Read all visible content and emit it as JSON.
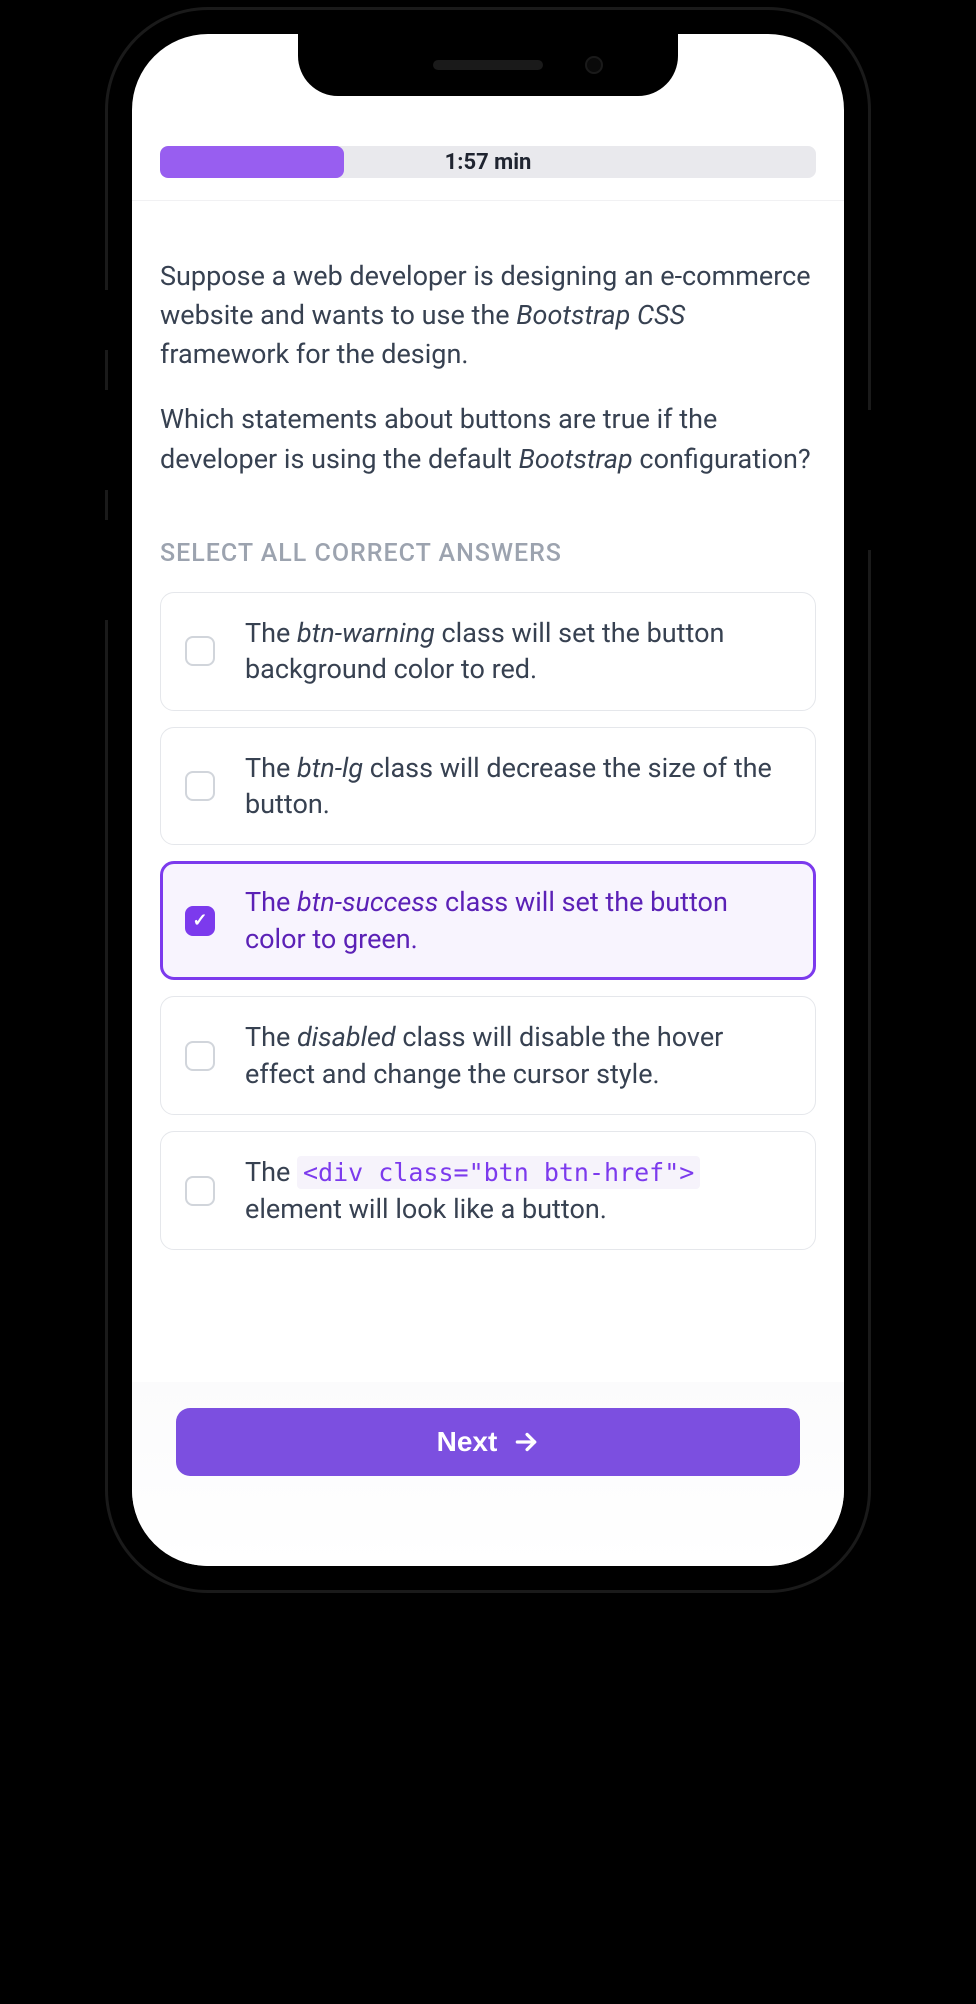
{
  "timer": {
    "label": "1:57 min",
    "progress_percent": 28
  },
  "question": {
    "para1_pre": "Suppose a web developer is designing an e-commerce website and wants to use the ",
    "para1_em": "Bootstrap CSS",
    "para1_post": " framework for the design.",
    "para2_pre": "Which statements about buttons are true if the developer is using the default ",
    "para2_em": "Bootstrap",
    "para2_post": " configuration?"
  },
  "instruction": "SELECT ALL CORRECT ANSWERS",
  "options": [
    {
      "pre": "The ",
      "em": "btn-warning",
      "post": " class will set the button background color to red.",
      "selected": false
    },
    {
      "pre": "The ",
      "em": "btn-lg",
      "post": " class will decrease the size of the button.",
      "selected": false
    },
    {
      "pre": "The ",
      "em": "btn-success",
      "post": " class will set the button color to green.",
      "selected": true
    },
    {
      "pre": "The ",
      "em": "disabled",
      "post": " class will disable the hover effect and change the cursor style.",
      "selected": false
    },
    {
      "pre": "The ",
      "code": "<div class=\"btn btn-href\">",
      "post": " element will look like a button.",
      "selected": false
    }
  ],
  "next_button": "Next"
}
